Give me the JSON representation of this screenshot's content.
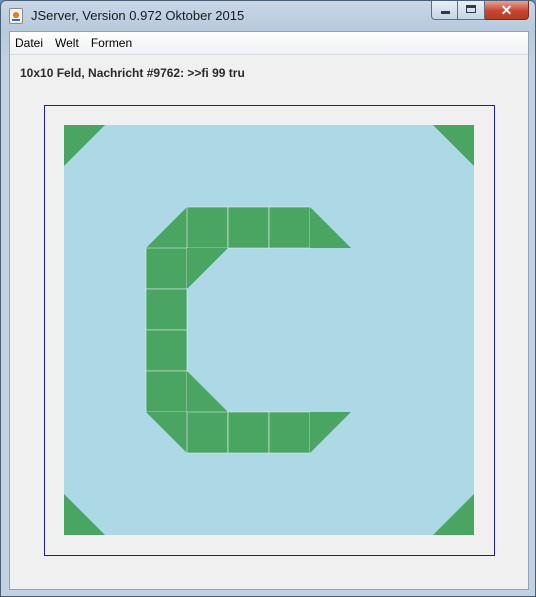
{
  "window": {
    "title": "JServer, Version 0.972 Oktober 2015"
  },
  "menu": {
    "items": [
      "Datei",
      "Welt",
      "Formen"
    ]
  },
  "status": {
    "text": "10x10 Feld, Nachricht #9762: >>fi 99 tru"
  },
  "board": {
    "rows": 10,
    "cols": 10,
    "background_color": "#add8e6",
    "shape_color": "#4aa462",
    "cell_divider_color": "#e8f4f8",
    "cells": [
      {
        "row": 0,
        "col": 0,
        "shape": "triangle-top-left"
      },
      {
        "row": 0,
        "col": 9,
        "shape": "triangle-top-right"
      },
      {
        "row": 9,
        "col": 0,
        "shape": "triangle-bottom-left"
      },
      {
        "row": 9,
        "col": 9,
        "shape": "triangle-bottom-right"
      },
      {
        "row": 2,
        "col": 2,
        "shape": "triangle-bottom-right"
      },
      {
        "row": 2,
        "col": 3,
        "shape": "square"
      },
      {
        "row": 2,
        "col": 4,
        "shape": "square"
      },
      {
        "row": 2,
        "col": 5,
        "shape": "square"
      },
      {
        "row": 2,
        "col": 6,
        "shape": "triangle-bottom-left"
      },
      {
        "row": 3,
        "col": 2,
        "shape": "square"
      },
      {
        "row": 3,
        "col": 3,
        "shape": "triangle-top-left"
      },
      {
        "row": 4,
        "col": 2,
        "shape": "square"
      },
      {
        "row": 5,
        "col": 2,
        "shape": "square"
      },
      {
        "row": 6,
        "col": 2,
        "shape": "square"
      },
      {
        "row": 6,
        "col": 3,
        "shape": "triangle-bottom-left"
      },
      {
        "row": 7,
        "col": 2,
        "shape": "triangle-top-right"
      },
      {
        "row": 7,
        "col": 3,
        "shape": "square"
      },
      {
        "row": 7,
        "col": 4,
        "shape": "square"
      },
      {
        "row": 7,
        "col": 5,
        "shape": "square"
      },
      {
        "row": 7,
        "col": 6,
        "shape": "triangle-top-left"
      }
    ]
  }
}
